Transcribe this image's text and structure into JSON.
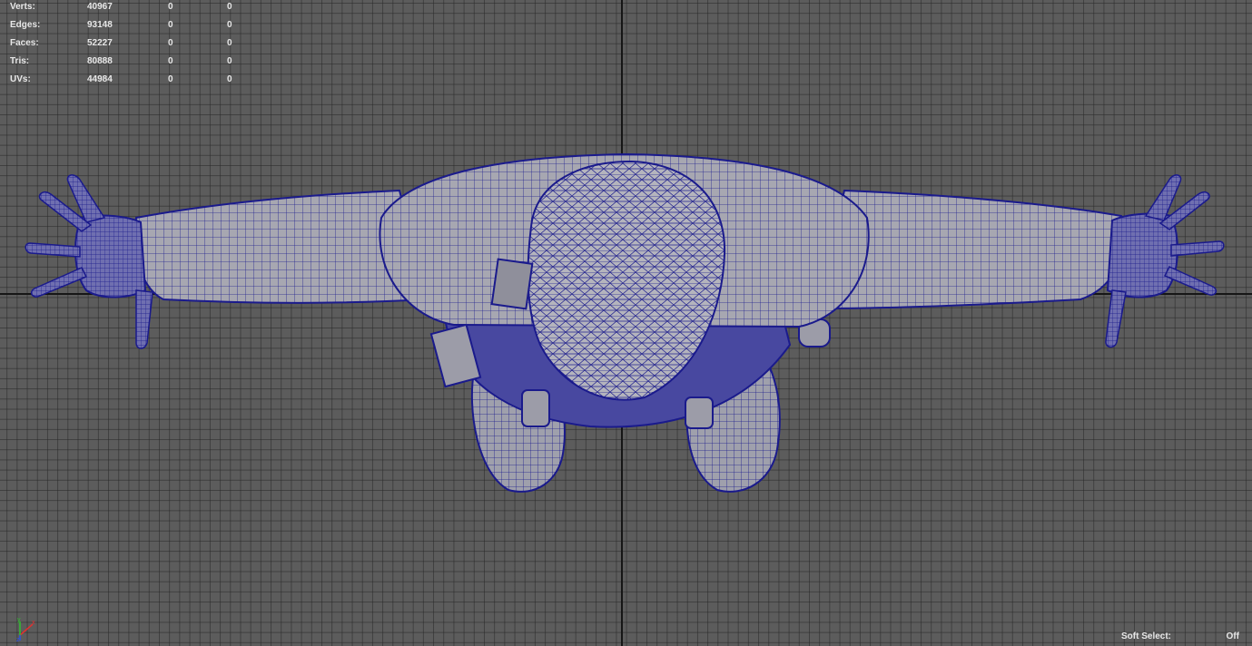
{
  "hud": {
    "rows": [
      {
        "label": "Verts:",
        "total": "40967",
        "selected": "0",
        "components": "0"
      },
      {
        "label": "Edges:",
        "total": "93148",
        "selected": "0",
        "components": "0"
      },
      {
        "label": "Faces:",
        "total": "52227",
        "selected": "0",
        "components": "0"
      },
      {
        "label": "Tris:",
        "total": "80888",
        "selected": "0",
        "components": "0"
      },
      {
        "label": "UVs:",
        "total": "44984",
        "selected": "0",
        "components": "0"
      }
    ]
  },
  "soft_select": {
    "label": "Soft Select:",
    "value": "Off"
  },
  "colors": {
    "viewport_bg": "#5c5c5c",
    "grid_line": "#3a3a3a",
    "axis_line": "#161616",
    "mesh_fill": "#a9a9b3",
    "wireframe": "#1a1a8c",
    "hud_text": "#e8e8e8",
    "gizmo_x": "#e03030",
    "gizmo_y": "#30c030",
    "gizmo_z": "#3050e0"
  },
  "axis_gizmo": {
    "icon": "axis-gizmo-icon"
  },
  "viewport": {
    "view": "top",
    "display_mode": "wireframe-on-shaded"
  }
}
